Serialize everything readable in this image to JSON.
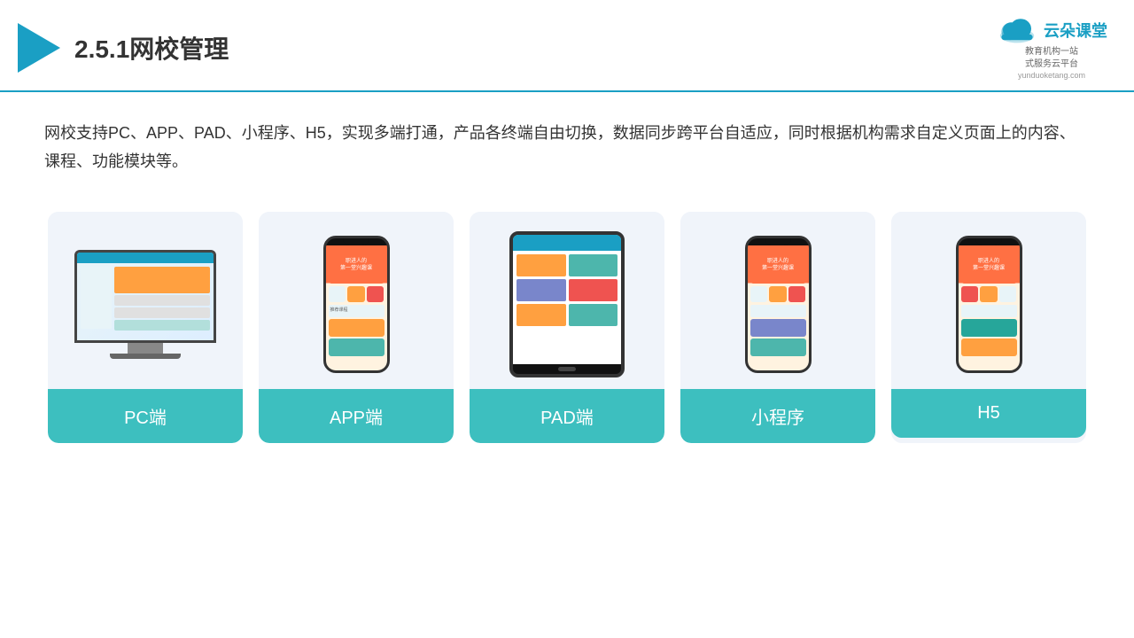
{
  "header": {
    "title": "2.5.1网校管理",
    "logo_main": "云朵课堂",
    "logo_url": "yunduoketang.com",
    "logo_slogan": "教育机构一站\n式服务云平台"
  },
  "description": "网校支持PC、APP、PAD、小程序、H5，实现多端打通，产品各终端自由切换，数据同步跨平台自适应，同时根据机构需求自定义页面上的内容、课程、功能模块等。",
  "cards": [
    {
      "label": "PC端"
    },
    {
      "label": "APP端"
    },
    {
      "label": "PAD端"
    },
    {
      "label": "小程序"
    },
    {
      "label": "H5"
    }
  ]
}
